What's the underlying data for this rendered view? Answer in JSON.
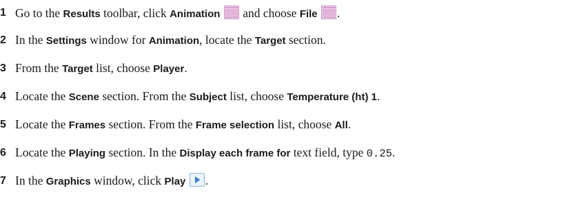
{
  "steps": [
    {
      "number": "1",
      "parts": [
        {
          "t": "Go to the ",
          "s": "plain"
        },
        {
          "t": "Results",
          "s": "ui"
        },
        {
          "t": " toolbar, click ",
          "s": "plain"
        },
        {
          "t": "Animation",
          "s": "ui"
        },
        {
          "icon": "animation-filmstrip-icon"
        },
        {
          "t": " and choose ",
          "s": "plain"
        },
        {
          "t": "File",
          "s": "ui"
        },
        {
          "icon": "file-filmstrip-icon"
        },
        {
          "t": ".",
          "s": "plain"
        }
      ]
    },
    {
      "number": "2",
      "parts": [
        {
          "t": "In the ",
          "s": "plain"
        },
        {
          "t": "Settings",
          "s": "ui"
        },
        {
          "t": " window for ",
          "s": "plain"
        },
        {
          "t": "Animation",
          "s": "ui"
        },
        {
          "t": ", locate the ",
          "s": "plain"
        },
        {
          "t": "Target",
          "s": "ui"
        },
        {
          "t": " section.",
          "s": "plain"
        }
      ]
    },
    {
      "number": "3",
      "parts": [
        {
          "t": "From the ",
          "s": "plain"
        },
        {
          "t": "Target",
          "s": "ui"
        },
        {
          "t": " list, choose ",
          "s": "plain"
        },
        {
          "t": "Player",
          "s": "ui"
        },
        {
          "t": ".",
          "s": "plain"
        }
      ]
    },
    {
      "number": "4",
      "parts": [
        {
          "t": "Locate the ",
          "s": "plain"
        },
        {
          "t": "Scene",
          "s": "ui"
        },
        {
          "t": " section. From the ",
          "s": "plain"
        },
        {
          "t": "Subject",
          "s": "ui"
        },
        {
          "t": " list, choose ",
          "s": "plain"
        },
        {
          "t": "Temperature (ht) 1",
          "s": "ui"
        },
        {
          "t": ".",
          "s": "plain"
        }
      ]
    },
    {
      "number": "5",
      "parts": [
        {
          "t": "Locate the ",
          "s": "plain"
        },
        {
          "t": "Frames",
          "s": "ui"
        },
        {
          "t": " section. From the ",
          "s": "plain"
        },
        {
          "t": "Frame selection",
          "s": "ui"
        },
        {
          "t": " list, choose ",
          "s": "plain"
        },
        {
          "t": "All",
          "s": "ui"
        },
        {
          "t": ".",
          "s": "plain"
        }
      ]
    },
    {
      "number": "6",
      "parts": [
        {
          "t": "Locate the ",
          "s": "plain"
        },
        {
          "t": "Playing",
          "s": "ui"
        },
        {
          "t": " section. In the ",
          "s": "plain"
        },
        {
          "t": "Display each frame for",
          "s": "ui"
        },
        {
          "t": " text field, type ",
          "s": "plain"
        },
        {
          "t": "0.25",
          "s": "mono"
        },
        {
          "t": ".",
          "s": "plain"
        }
      ]
    },
    {
      "number": "7",
      "parts": [
        {
          "t": "In the ",
          "s": "plain"
        },
        {
          "t": "Graphics",
          "s": "ui"
        },
        {
          "t": " window, click ",
          "s": "plain"
        },
        {
          "t": "Play",
          "s": "ui"
        },
        {
          "icon": "play-icon"
        },
        {
          "t": ".",
          "s": "plain"
        }
      ]
    }
  ]
}
